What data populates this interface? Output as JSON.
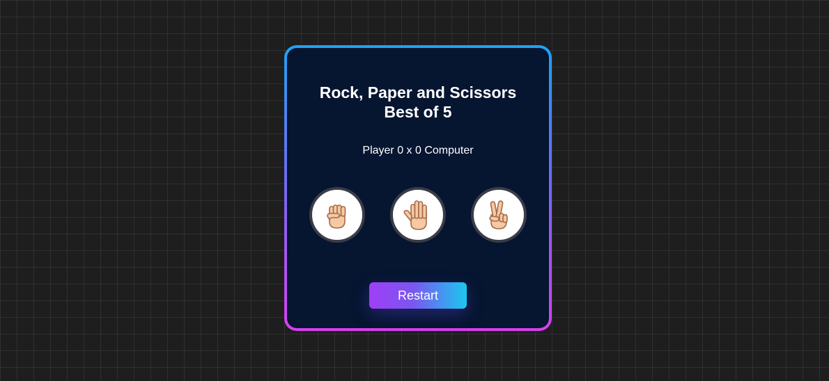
{
  "game": {
    "title_line1": "Rock, Paper and Scissors",
    "title_line2": "Best of 5",
    "score_text": "Player 0 x 0 Computer",
    "choices": [
      {
        "name": "rock",
        "icon": "raised-fist-icon"
      },
      {
        "name": "paper",
        "icon": "raised-hand-icon"
      },
      {
        "name": "scissors",
        "icon": "victory-hand-icon"
      }
    ],
    "restart_label": "Restart"
  },
  "colors": {
    "background": "#1d1e1d",
    "card": "#061530",
    "border_top": "#1fa2f5",
    "border_bottom": "#d93ff0",
    "button_start": "#a03ef6",
    "button_end": "#1bc8ef",
    "skin": "#f5c9a3",
    "skin_outline": "#a5694a"
  }
}
